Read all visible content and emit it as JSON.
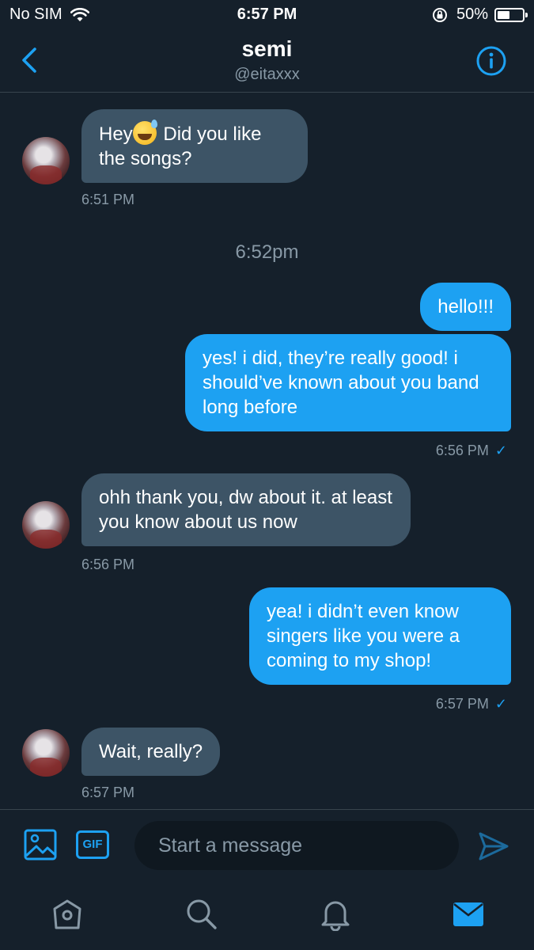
{
  "status_bar": {
    "carrier": "No SIM",
    "time": "6:57 PM",
    "battery": "50%",
    "battery_level": 0.5
  },
  "header": {
    "name": "semi",
    "handle": "@eitaxxx"
  },
  "messages": [
    {
      "text_before": "Hey",
      "text_after": " Did you like the songs?",
      "time": "6:51 PM"
    },
    {
      "divider": "6:52pm"
    },
    {
      "text": "hello!!!"
    },
    {
      "text": "yes! i did, they’re really good! i should’ve known about you band long before",
      "time": "6:56 PM",
      "status": "✓"
    },
    {
      "text": "ohh thank you, dw about it. at least you know about us now",
      "time": "6:56 PM"
    },
    {
      "text": "yea! i didn’t even know singers like you were a coming to my shop!",
      "time": "6:57 PM",
      "status": "✓"
    },
    {
      "text": "Wait, really?",
      "time": "6:57 PM"
    }
  ],
  "composer": {
    "gif_label": "GIF",
    "placeholder": "Start a message"
  },
  "colors": {
    "background": "#15202b",
    "accent": "#1da1f2",
    "incoming_bubble": "#3d5466",
    "muted": "#8899a6"
  },
  "icons": [
    "wifi-icon",
    "orientation-lock-icon",
    "battery-icon",
    "back-chevron-icon",
    "info-icon",
    "image-icon",
    "send-icon",
    "home-icon",
    "search-icon",
    "bell-icon",
    "mail-icon"
  ]
}
